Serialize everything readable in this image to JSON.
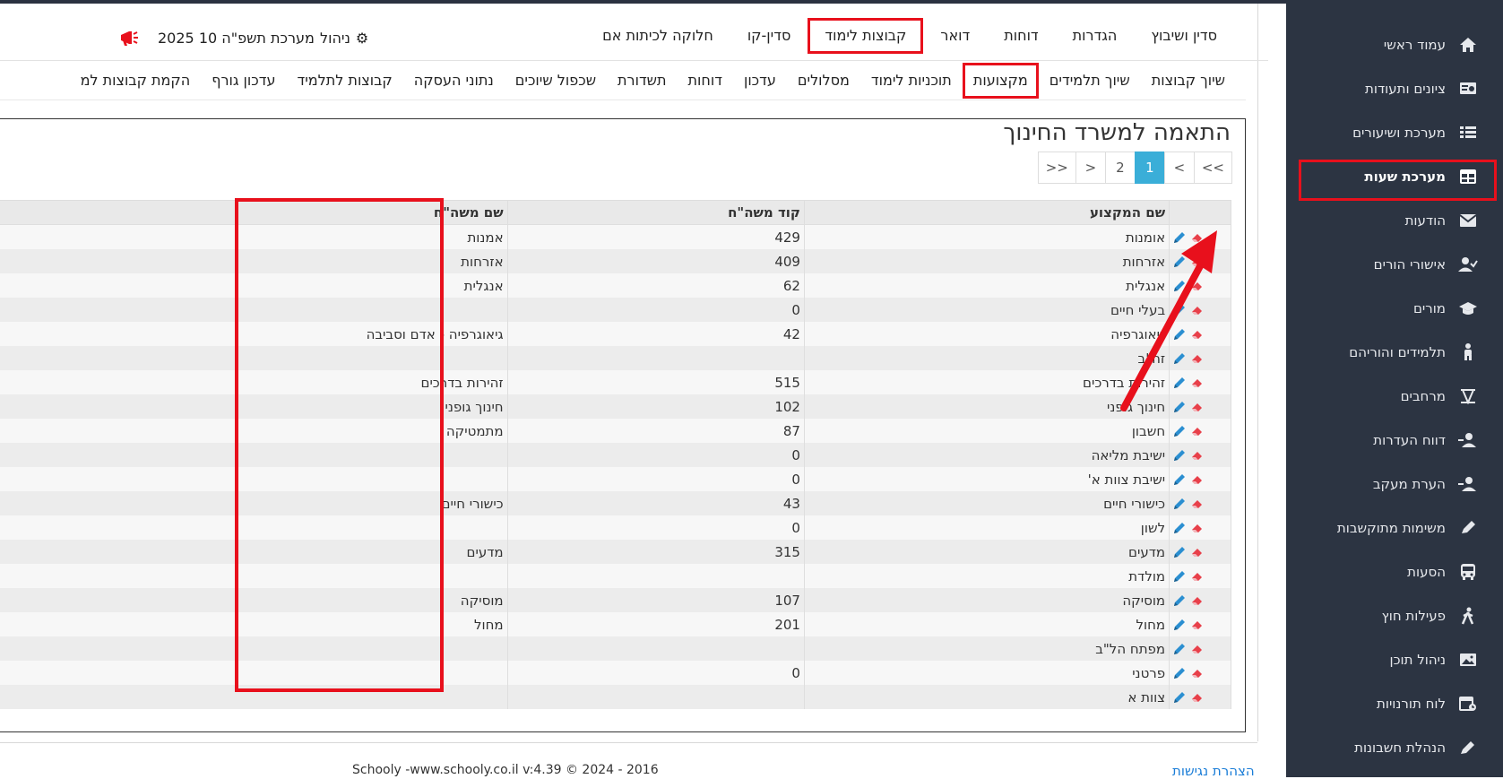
{
  "colors": {
    "sidebar_bg": "#2c3442",
    "highlight": "#e8101c",
    "pager_active": "#3aaed8",
    "link": "#1a7dd7"
  },
  "sidebar": {
    "items": [
      {
        "label": "עמוד ראשי",
        "icon": "home-icon"
      },
      {
        "label": "ציונים ותעודות",
        "icon": "certificate-icon"
      },
      {
        "label": "מערכת ושיעורים",
        "icon": "list-icon"
      },
      {
        "label": "מערכת שעות",
        "icon": "grid-table-icon",
        "active": true
      },
      {
        "label": "הודעות",
        "icon": "envelope-icon"
      },
      {
        "label": "אישורי הורים",
        "icon": "user-check-icon"
      },
      {
        "label": "מורים",
        "icon": "graduation-cap-icon"
      },
      {
        "label": "תלמידים והוריהם",
        "icon": "child-icon"
      },
      {
        "label": "מרחבים",
        "icon": "space-icon"
      },
      {
        "label": "דווח העדרות",
        "icon": "user-minus-icon"
      },
      {
        "label": "הערת מעקב",
        "icon": "user-note-icon"
      },
      {
        "label": "משימות מתוקשבות",
        "icon": "pencil-icon"
      },
      {
        "label": "הסעות",
        "icon": "bus-icon"
      },
      {
        "label": "פעילות חוץ",
        "icon": "walking-icon"
      },
      {
        "label": "ניהול תוכן",
        "icon": "image-icon"
      },
      {
        "label": "לוח תורנויות",
        "icon": "calendar-icon"
      },
      {
        "label": "הנהלת חשבונות",
        "icon": "pen-icon"
      }
    ]
  },
  "nav1": {
    "items": [
      "סדין ושיבוץ",
      "הגדרות",
      "דוחות",
      "דואר",
      "קבוצות לימוד",
      "סדין-קו",
      "חלוקה לכיתות אם"
    ],
    "highlighted_index": 4
  },
  "system": {
    "manage_label": "ניהול",
    "system_label": "מערכת תשפ\"ה 10 2025"
  },
  "nav2": {
    "items": [
      "שיוך קבוצות",
      "שיוך תלמידים",
      "מקצועות",
      "תוכניות לימוד",
      "מסלולים",
      "עדכון",
      "דוחות",
      "תשדורת",
      "שכפול שיוכים",
      "נתוני העסקה",
      "קבוצות לתלמיד",
      "עדכון גורף",
      "הקמת קבוצות למ"
    ],
    "highlighted_index": 2
  },
  "page": {
    "title": "התאמה למשרד החינוך"
  },
  "pager": {
    "items": [
      "<<",
      "<",
      "1",
      "2",
      ">",
      ">>"
    ],
    "active": "1"
  },
  "table": {
    "headers": {
      "subject": "שם המקצוע",
      "code": "קוד משה\"ח",
      "name": "שם משה\"ח"
    },
    "rows": [
      {
        "subject": "אומנות",
        "code": "429",
        "name": "אמנות"
      },
      {
        "subject": "אזרחות",
        "code": "409",
        "name": "אזרחות"
      },
      {
        "subject": "אנגלית",
        "code": "62",
        "name": "אנגלית"
      },
      {
        "subject": "בעלי חיים",
        "code": "0",
        "name": ""
      },
      {
        "subject": "גיאוגרפיה",
        "code": "42",
        "name": "גיאוגרפיה - אדם וסביבה"
      },
      {
        "subject": "זה\"ב",
        "code": "",
        "name": ""
      },
      {
        "subject": "זהירות בדרכים",
        "code": "515",
        "name": "זהירות בדרכים"
      },
      {
        "subject": "חינוך גופני",
        "code": "102",
        "name": "חינוך גופני"
      },
      {
        "subject": "חשבון",
        "code": "87",
        "name": "מתמטיקה"
      },
      {
        "subject": "ישיבת מליאה",
        "code": "0",
        "name": ""
      },
      {
        "subject": "ישיבת צוות א'",
        "code": "0",
        "name": ""
      },
      {
        "subject": "כישורי חיים",
        "code": "43",
        "name": "כישורי חיים"
      },
      {
        "subject": "לשון",
        "code": "0",
        "name": ""
      },
      {
        "subject": "מדעים",
        "code": "315",
        "name": "מדעים"
      },
      {
        "subject": "מולדת",
        "code": "",
        "name": ""
      },
      {
        "subject": "מוסיקה",
        "code": "107",
        "name": "מוסיקה"
      },
      {
        "subject": "מחול",
        "code": "201",
        "name": "מחול"
      },
      {
        "subject": "מפתח הל\"ב",
        "code": "",
        "name": ""
      },
      {
        "subject": "פרטני",
        "code": "0",
        "name": ""
      },
      {
        "subject": "צוות א",
        "code": "",
        "name": ""
      }
    ]
  },
  "footer": {
    "copyright": "Schooly -www.schooly.co.il v:4.39 © 2024 - 2016",
    "accessibility": "הצהרת נגישות"
  }
}
